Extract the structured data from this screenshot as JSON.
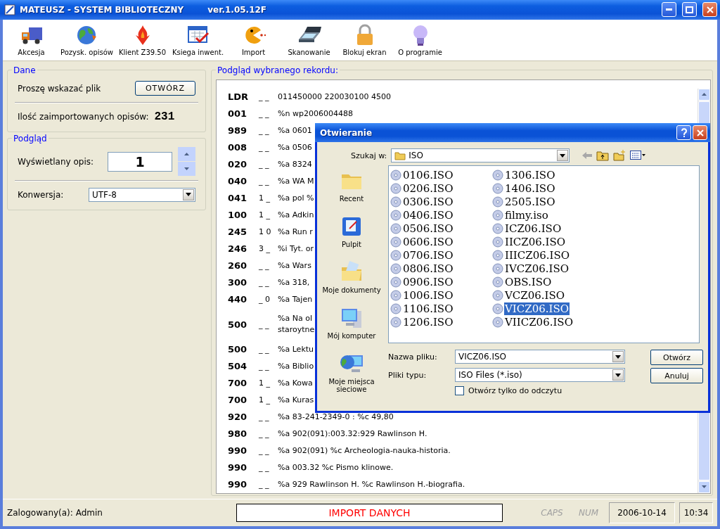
{
  "window": {
    "title": "MATEUSZ - SYSTEM BIBLIOTECZNY",
    "version": "ver.1.05.12F"
  },
  "toolbar": [
    {
      "label": "Akcesja",
      "kind": "truck"
    },
    {
      "label": "Pozysk. opisów",
      "kind": "globe"
    },
    {
      "label": "Klient Z39.50",
      "kind": "flame"
    },
    {
      "label": "Ksiega inwent.",
      "kind": "calendar"
    },
    {
      "label": "Import",
      "kind": "pacman"
    },
    {
      "label": "Skanowanie",
      "kind": "scanner"
    },
    {
      "label": "Blokuj ekran",
      "kind": "padlock"
    },
    {
      "label": "O programie",
      "kind": "bulb"
    }
  ],
  "dane": {
    "legend": "Dane",
    "prompt": "Proszę wskazać plik",
    "open_button": "OTWÓRZ",
    "count_label": "Ilość zaimportowanych opisów:",
    "count": "231"
  },
  "podglad": {
    "legend": "Podgląd",
    "displayed_label": "Wyświetlany opis:",
    "displayed_value": "1",
    "conversion_label": "Konwersja:",
    "conversion_value": "UTF-8"
  },
  "record": {
    "legend": "Podgląd wybranego rekordu:",
    "rows": [
      {
        "tag": "LDR",
        "ind": "_ _",
        "value": "011450000 220030100 4500"
      },
      {
        "tag": "001",
        "ind": "_ _",
        "value": "%n wp2006004488"
      },
      {
        "tag": "989",
        "ind": "_ _",
        "value": "%a 0601"
      },
      {
        "tag": "008",
        "ind": "_ _",
        "value": "%a 0506"
      },
      {
        "tag": "020",
        "ind": "_ _",
        "value": "%a 8324"
      },
      {
        "tag": "040",
        "ind": "_ _",
        "value": "%a WA M"
      },
      {
        "tag": "041",
        "ind": "1 _",
        "value": "%a pol %"
      },
      {
        "tag": "100",
        "ind": "1 _",
        "value": "%a Adkin"
      },
      {
        "tag": "245",
        "ind": "1 0",
        "value": "%a Run r"
      },
      {
        "tag": "246",
        "ind": "3 _",
        "value": "%i Tyt. or"
      },
      {
        "tag": "260",
        "ind": "_ _",
        "value": "%a Wars"
      },
      {
        "tag": "300",
        "ind": "_ _",
        "value": "%a 318,"
      },
      {
        "tag": "440",
        "ind": "_ 0",
        "value": "%a Tajen"
      },
      {
        "tag": "500",
        "ind": "_ _",
        "value": "%a Na ol",
        "value_2": "staroytne"
      },
      {
        "tag": "500",
        "ind": "_ _",
        "value": "%a Lektu"
      },
      {
        "tag": "504",
        "ind": "_ _",
        "value": "%a Biblio"
      },
      {
        "tag": "700",
        "ind": "1 _",
        "value": "%a Kowa"
      },
      {
        "tag": "700",
        "ind": "1 _",
        "value": "%a Kuras"
      },
      {
        "tag": "920",
        "ind": "_ _",
        "value": "%a 83-241-2349-0 : %c 49,80"
      },
      {
        "tag": "980",
        "ind": "_ _",
        "value": "%a 902(091):003.32:929 Rawlinson H."
      },
      {
        "tag": "990",
        "ind": "_ _",
        "value": "%a 902(091) %c Archeologia-nauka-historia."
      },
      {
        "tag": "990",
        "ind": "_ _",
        "value": "%a 003.32 %c Pismo klinowe."
      },
      {
        "tag": "990",
        "ind": "_ _",
        "value": "%a 929 Rawlinson H. %c Rawlinson H.-biografia."
      }
    ]
  },
  "dialog": {
    "title": "Otwieranie",
    "look_in_label": "Szukaj w:",
    "look_in_value": "ISO",
    "places": [
      {
        "label": "Recent",
        "kind": "folder"
      },
      {
        "label": "Pulpit",
        "kind": "desktop"
      },
      {
        "label": "Moje dokumenty",
        "kind": "documents"
      },
      {
        "label": "Mój komputer",
        "kind": "computer"
      },
      {
        "label": "Moje miejsca sieciowe",
        "kind": "network"
      }
    ],
    "files": [
      {
        "name": "0106.ISO",
        "selected": false
      },
      {
        "name": "0206.ISO",
        "selected": false
      },
      {
        "name": "0306.ISO",
        "selected": false
      },
      {
        "name": "0406.ISO",
        "selected": false
      },
      {
        "name": "0506.ISO",
        "selected": false
      },
      {
        "name": "0606.ISO",
        "selected": false
      },
      {
        "name": "0706.ISO",
        "selected": false
      },
      {
        "name": "0806.ISO",
        "selected": false
      },
      {
        "name": "0906.ISO",
        "selected": false
      },
      {
        "name": "1006.ISO",
        "selected": false
      },
      {
        "name": "1106.ISO",
        "selected": false
      },
      {
        "name": "1206.ISO",
        "selected": false
      },
      {
        "name": "1306.ISO",
        "selected": false
      },
      {
        "name": "1406.ISO",
        "selected": false
      },
      {
        "name": "2505.ISO",
        "selected": false
      },
      {
        "name": "filmy.iso",
        "selected": false
      },
      {
        "name": "ICZ06.ISO",
        "selected": false
      },
      {
        "name": "IICZ06.ISO",
        "selected": false
      },
      {
        "name": "IIICZ06.ISO",
        "selected": false
      },
      {
        "name": "IVCZ06.ISO",
        "selected": false
      },
      {
        "name": "OBS.ISO",
        "selected": false
      },
      {
        "name": "VCZ06.ISO",
        "selected": false
      },
      {
        "name": "VICZ06.ISO",
        "selected": true
      },
      {
        "name": "VIICZ06.ISO",
        "selected": false
      }
    ],
    "filename_label": "Nazwa pliku:",
    "filename_value": "VICZ06.ISO",
    "filetype_label": "Pliki typu:",
    "filetype_value": "ISO Files (*.iso)",
    "readonly_label": "Otwórz tylko do odczytu",
    "readonly_checked": false,
    "open_button": "Otwórz",
    "cancel_button": "Anuluj"
  },
  "status_bar": {
    "user": "Zalogowany(a): Admin",
    "message": "IMPORT DANYCH",
    "caps": {
      "label": "CAPS",
      "on": false
    },
    "num": {
      "label": "NUM",
      "on": false
    },
    "date": "2006-10-14",
    "time": "10:34"
  }
}
